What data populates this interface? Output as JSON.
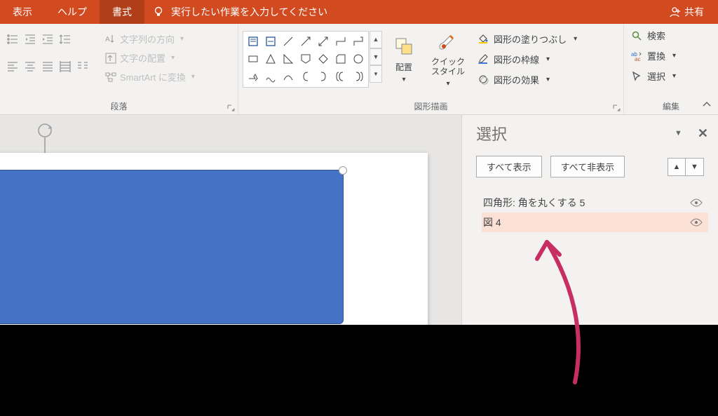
{
  "titlebar": {
    "tabs": [
      "表示",
      "ヘルプ",
      "書式"
    ],
    "active_tab_index": 2,
    "search_placeholder": "実行したい作業を入力してください",
    "share_label": "共有"
  },
  "ribbon": {
    "paragraph": {
      "label": "段落",
      "text_direction": "文字列の方向",
      "text_align": "文字の配置",
      "smartart": "SmartArt に変換"
    },
    "drawing": {
      "label": "図形描画",
      "arrange": "配置",
      "quick_style": "クイック\nスタイル",
      "fill": "図形の塗りつぶし",
      "outline": "図形の枠線",
      "effects": "図形の効果"
    },
    "editing": {
      "label": "編集",
      "find": "検索",
      "replace": "置換",
      "select": "選択"
    }
  },
  "selection_pane": {
    "title": "選択",
    "show_all": "すべて表示",
    "hide_all": "すべて非表示",
    "items": [
      {
        "label": "四角形: 角を丸くする 5",
        "selected": false
      },
      {
        "label": "図 4",
        "selected": true
      }
    ]
  }
}
